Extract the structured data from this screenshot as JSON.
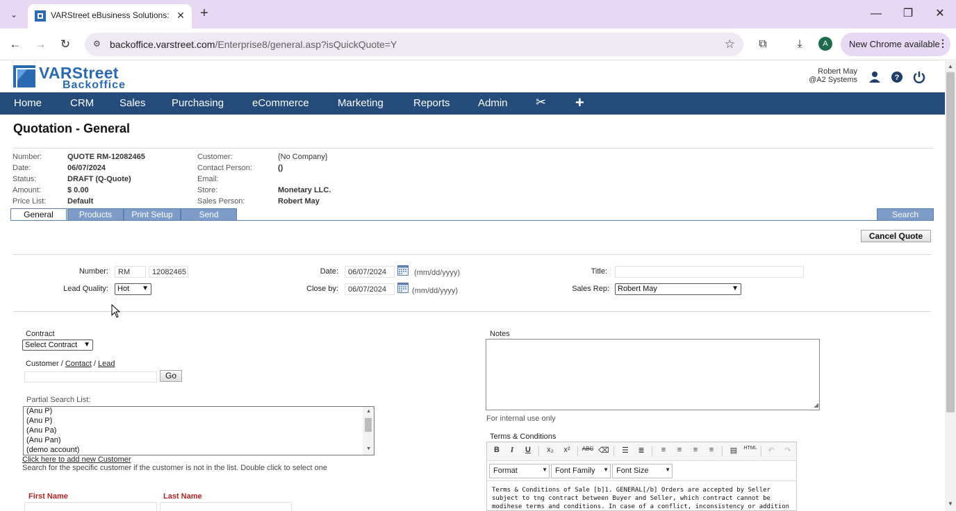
{
  "browser": {
    "tab_title": "VARStreet eBusiness Solutions:",
    "url_host": "backoffice.varstreet.com",
    "url_path": "/Enterprise8/general.asp?isQuickQuote=Y",
    "profile_initial": "A",
    "update_label": "New Chrome available"
  },
  "header": {
    "logo_line1": "VARStreet",
    "logo_line2": "Backoffice",
    "user_name": "Robert May",
    "user_company": "@A2 Systems"
  },
  "nav": {
    "items": [
      "Home",
      "CRM",
      "Sales",
      "Purchasing",
      "eCommerce",
      "Marketing",
      "Reports",
      "Admin"
    ]
  },
  "page_title": "Quotation - General",
  "summary": {
    "number_label": "Number:",
    "number_value": "QUOTE  RM-12082465",
    "date_label": "Date:",
    "date_value": "06/07/2024",
    "status_label": "Status:",
    "status_value": "DRAFT (Q-Quote)",
    "amount_label": "Amount:",
    "amount_value": "$ 0.00",
    "pricelist_label": "Price List:",
    "pricelist_value": "Default",
    "customer_label": "Customer:",
    "customer_value": "{No Company}",
    "contact_label": "Contact Person:",
    "contact_value": "()",
    "email_label": "Email:",
    "email_value": "",
    "store_label": "Store:",
    "store_value": "Monetary LLC.",
    "salesperson_label": "Sales Person:",
    "salesperson_value": "Robert May"
  },
  "subtabs": [
    "General",
    "Products",
    "Print Setup",
    "Send"
  ],
  "search_button": "Search",
  "cancel_button": "Cancel Quote",
  "form": {
    "number_label": "Number:",
    "number_prefix": "RM",
    "number_value": "12082465",
    "lead_quality_label": "Lead Quality:",
    "lead_quality_value": "Hot",
    "date_label": "Date:",
    "date_value": "06/07/2024",
    "date_hint": "(mm/dd/yyyy)",
    "closeby_label": "Close by:",
    "closeby_value": "06/07/2024",
    "closeby_hint": "(mm/dd/yyyy)",
    "title_label": "Title:",
    "title_value": "",
    "salesrep_label": "Sales Rep:",
    "salesrep_value": "Robert May"
  },
  "left": {
    "contract_label": "Contract",
    "contract_value": "Select Contract",
    "customer_label": "Customer /",
    "contact_link": "Contact",
    "slash": "/",
    "lead_link": "Lead",
    "go_button": "Go",
    "partial_label": "Partial Search List:",
    "list_items": [
      "(Anu P)",
      "(Anu P)",
      "(Anu Pa)",
      "(Anu Pan)",
      "(demo account)"
    ],
    "add_customer_link": "Click here to add new Customer",
    "search_hint": "Search for the specific customer if the customer is not in the list. Double click to select one",
    "first_name_label": "First Name",
    "last_name_label": "Last Name"
  },
  "right": {
    "notes_label": "Notes",
    "notes_hint": "For internal use only",
    "terms_label": "Terms & Conditions",
    "format_select": "Format",
    "font_family_select": "Font Family",
    "font_size_select": "Font Size",
    "terms_text": "Terms & Conditions of Sale [b]1. GENERAL[/b] Orders are accepted by Seller subject to tng contract between Buyer and Seller, which contract cannot be modihese terms and conditions. In case of a conflict, inconsistency or addition not"
  },
  "colors": {
    "nav_bg": "#244b7a",
    "tab_inactive": "#7d9cc8",
    "logo_blue": "#2a6ab3",
    "required_red": "#b32222"
  }
}
